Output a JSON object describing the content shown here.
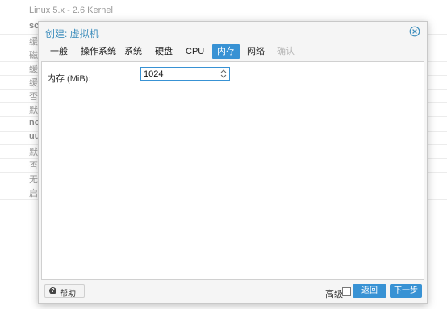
{
  "background_list": [
    {
      "text": "Linux 5.x - 2.6 Kernel",
      "bold": false
    },
    {
      "text": "scs",
      "bold": true
    },
    {
      "text": "缓",
      "bold": false
    },
    {
      "text": "磁",
      "bold": false
    },
    {
      "text": "缓",
      "bold": false
    },
    {
      "text": "缓",
      "bold": false
    },
    {
      "text": "否",
      "bold": false
    },
    {
      "text": "默",
      "bold": false
    },
    {
      "text": "nor",
      "bold": true
    },
    {
      "text": "uui",
      "bold": true
    },
    {
      "text": "默",
      "bold": false
    },
    {
      "text": "否",
      "bold": false
    },
    {
      "text": "无",
      "bold": false
    },
    {
      "text": "启",
      "bold": false
    }
  ],
  "dialog": {
    "title": "创建: 虚拟机",
    "tabs": [
      {
        "label": "一般",
        "state": "normal"
      },
      {
        "label": "操作系统",
        "state": "normal"
      },
      {
        "label": "系统",
        "state": "normal"
      },
      {
        "label": "硬盘",
        "state": "normal"
      },
      {
        "label": "CPU",
        "state": "normal"
      },
      {
        "label": "内存",
        "state": "active"
      },
      {
        "label": "网络",
        "state": "normal"
      },
      {
        "label": "确认",
        "state": "disabled"
      }
    ],
    "memory_field": {
      "label": "内存 (MiB):",
      "value": "1024"
    },
    "footer": {
      "help_label": "帮助",
      "advanced_label": "高级",
      "advanced_checked": false,
      "back_label": "返回",
      "next_label": "下一步"
    }
  },
  "colors": {
    "accent": "#3892d4",
    "title": "#3c8dbc"
  }
}
